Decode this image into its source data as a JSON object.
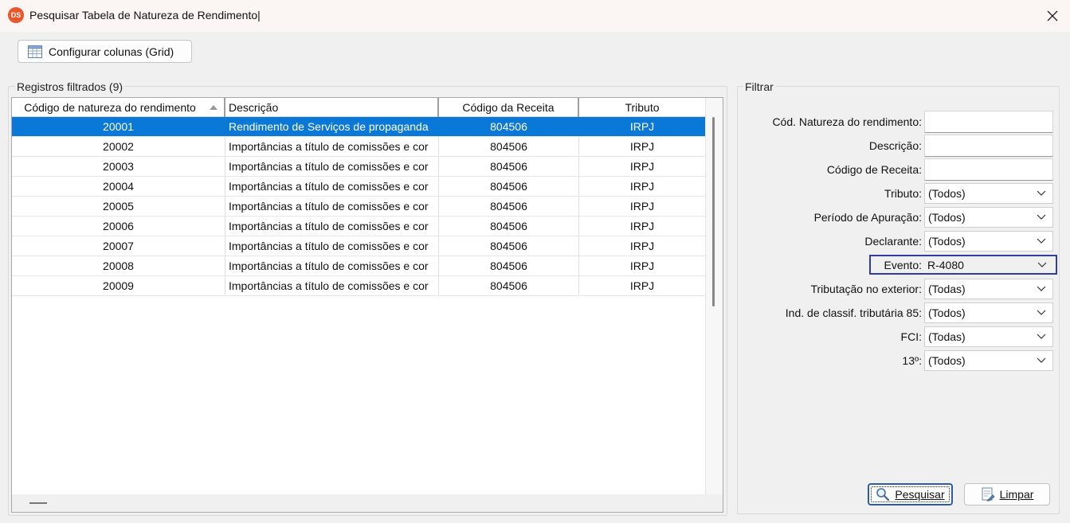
{
  "window": {
    "title": "Pesquisar Tabela de Natureza de Rendimento|",
    "app_icon_text": "DS",
    "close_icon": "close-icon"
  },
  "toolbar": {
    "config_label": "Configurar colunas (Grid)",
    "config_icon": "grid-table-icon"
  },
  "records": {
    "label": "Registros filtrados (9)",
    "columns": [
      "Código de natureza do rendimento",
      "Descrição",
      "Código da Receita",
      "Tributo"
    ],
    "rows": [
      {
        "codigo": "20001",
        "descricao": "Rendimento de Serviços de propaganda",
        "receita": "804506",
        "tributo": "IRPJ"
      },
      {
        "codigo": "20002",
        "descricao": "Importâncias a título de comissões e cor",
        "receita": "804506",
        "tributo": "IRPJ"
      },
      {
        "codigo": "20003",
        "descricao": "Importâncias a título de comissões e cor",
        "receita": "804506",
        "tributo": "IRPJ"
      },
      {
        "codigo": "20004",
        "descricao": "Importâncias a título de comissões e cor",
        "receita": "804506",
        "tributo": "IRPJ"
      },
      {
        "codigo": "20005",
        "descricao": "Importâncias a título de comissões e cor",
        "receita": "804506",
        "tributo": "IRPJ"
      },
      {
        "codigo": "20006",
        "descricao": "Importâncias a título de comissões e cor",
        "receita": "804506",
        "tributo": "IRPJ"
      },
      {
        "codigo": "20007",
        "descricao": "Importâncias a título de comissões e cor",
        "receita": "804506",
        "tributo": "IRPJ"
      },
      {
        "codigo": "20008",
        "descricao": "Importâncias a título de comissões e cor",
        "receita": "804506",
        "tributo": "IRPJ"
      },
      {
        "codigo": "20009",
        "descricao": "Importâncias a título de comissões e cor",
        "receita": "804506",
        "tributo": "IRPJ"
      }
    ]
  },
  "filter": {
    "label": "Filtrar",
    "cod_natureza_label": "Cód. Natureza do rendimento:",
    "cod_natureza_value": "",
    "descricao_label": "Descrição:",
    "descricao_value": "",
    "codigo_receita_label": "Código de Receita:",
    "codigo_receita_value": "",
    "tributo_label": "Tributo:",
    "tributo_value": "(Todos)",
    "periodo_label": "Período de Apuração:",
    "periodo_value": "(Todos)",
    "declarante_label": "Declarante:",
    "declarante_value": "(Todos)",
    "evento_label": "Evento:",
    "evento_value": "R-4080",
    "tributacao_label": "Tributação no exterior:",
    "tributacao_value": "(Todas)",
    "ind_classif_label": "Ind. de classif. tributária 85:",
    "ind_classif_value": "(Todos)",
    "fci_label": "FCI:",
    "fci_value": "(Todas)",
    "decimo_label": "13º:",
    "decimo_value": "(Todos)"
  },
  "actions": {
    "pesquisar_label": "Pesquisar",
    "limpar_label": "Limpar"
  },
  "colors": {
    "selection": "#0a78d7",
    "highlight_border": "#2f3ea0",
    "app_icon": "#e8562a"
  }
}
